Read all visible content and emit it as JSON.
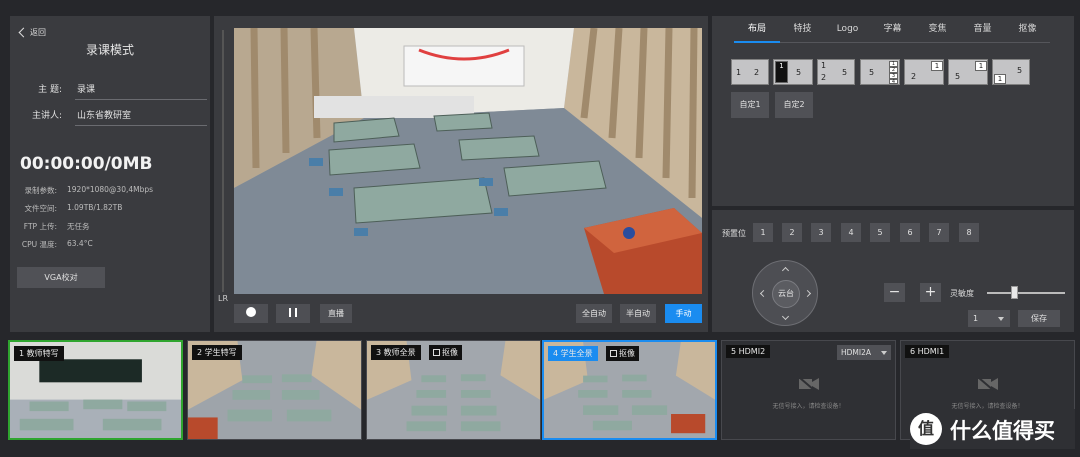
{
  "left": {
    "back_label": "返回",
    "title": "录课模式",
    "fields": [
      {
        "label": "主 题:",
        "value": "录课"
      },
      {
        "label": "主讲人:",
        "value": "山东省教研室"
      }
    ],
    "timer": "00:00:00/0MB",
    "stats": [
      {
        "key": "录制参数:",
        "value": "1920*1080@30,4Mbps"
      },
      {
        "key": "文件空间:",
        "value": "1.09TB/1.82TB"
      },
      {
        "key": "FTP 上传:",
        "value": "无任务"
      },
      {
        "key": "CPU 温度:",
        "value": "63.4°C"
      }
    ],
    "vga_button": "VGA校对"
  },
  "preview": {
    "lr_label": "LR",
    "live_label": "直播",
    "modes": [
      "全自动",
      "半自动",
      "手动"
    ],
    "active_mode": "手动"
  },
  "tabs": [
    "布局",
    "特技",
    "Logo",
    "字幕",
    "变焦",
    "音量",
    "抠像"
  ],
  "active_tab": "布局",
  "layouts": {
    "l1": [
      "1",
      "2"
    ],
    "l2": [
      "1",
      "5"
    ],
    "l3": [
      "1",
      "2",
      "5"
    ],
    "l4": [
      "5",
      "1",
      "2",
      "3",
      "4"
    ],
    "l5": [
      "1",
      "2"
    ],
    "l6": [
      "1",
      "5"
    ],
    "l7": [
      "1",
      "5"
    ],
    "custom": [
      "自定1",
      "自定2"
    ]
  },
  "presets": {
    "label": "预置位",
    "items": [
      "1",
      "2",
      "3",
      "4",
      "5",
      "6",
      "7",
      "8"
    ]
  },
  "ptz": {
    "center": "云台"
  },
  "zoom": {
    "minus": "−",
    "plus": "+"
  },
  "sensitivity": {
    "label": "灵敏度",
    "level": 0.35
  },
  "preset_select": "1",
  "save_label": "保存",
  "thumbs": [
    {
      "label": "1 教师特写"
    },
    {
      "label": "2 学生特写"
    },
    {
      "label": "3 教师全景",
      "check": "抠像"
    },
    {
      "label": "4 学生全景",
      "check": "抠像"
    },
    {
      "label": "5 HDMI2",
      "select": "HDMI2A",
      "no_signal": "无信号接入，请检查设备！"
    },
    {
      "label": "6 HDMI1",
      "no_signal": "无信号接入，请检查设备！"
    }
  ],
  "brand": {
    "logo": "值",
    "text": "什么值得买"
  },
  "colors": {
    "accent": "#1a8cf0",
    "active_green": "#2fa52f",
    "panel": "#3a3b3f",
    "background": "#26272b"
  }
}
